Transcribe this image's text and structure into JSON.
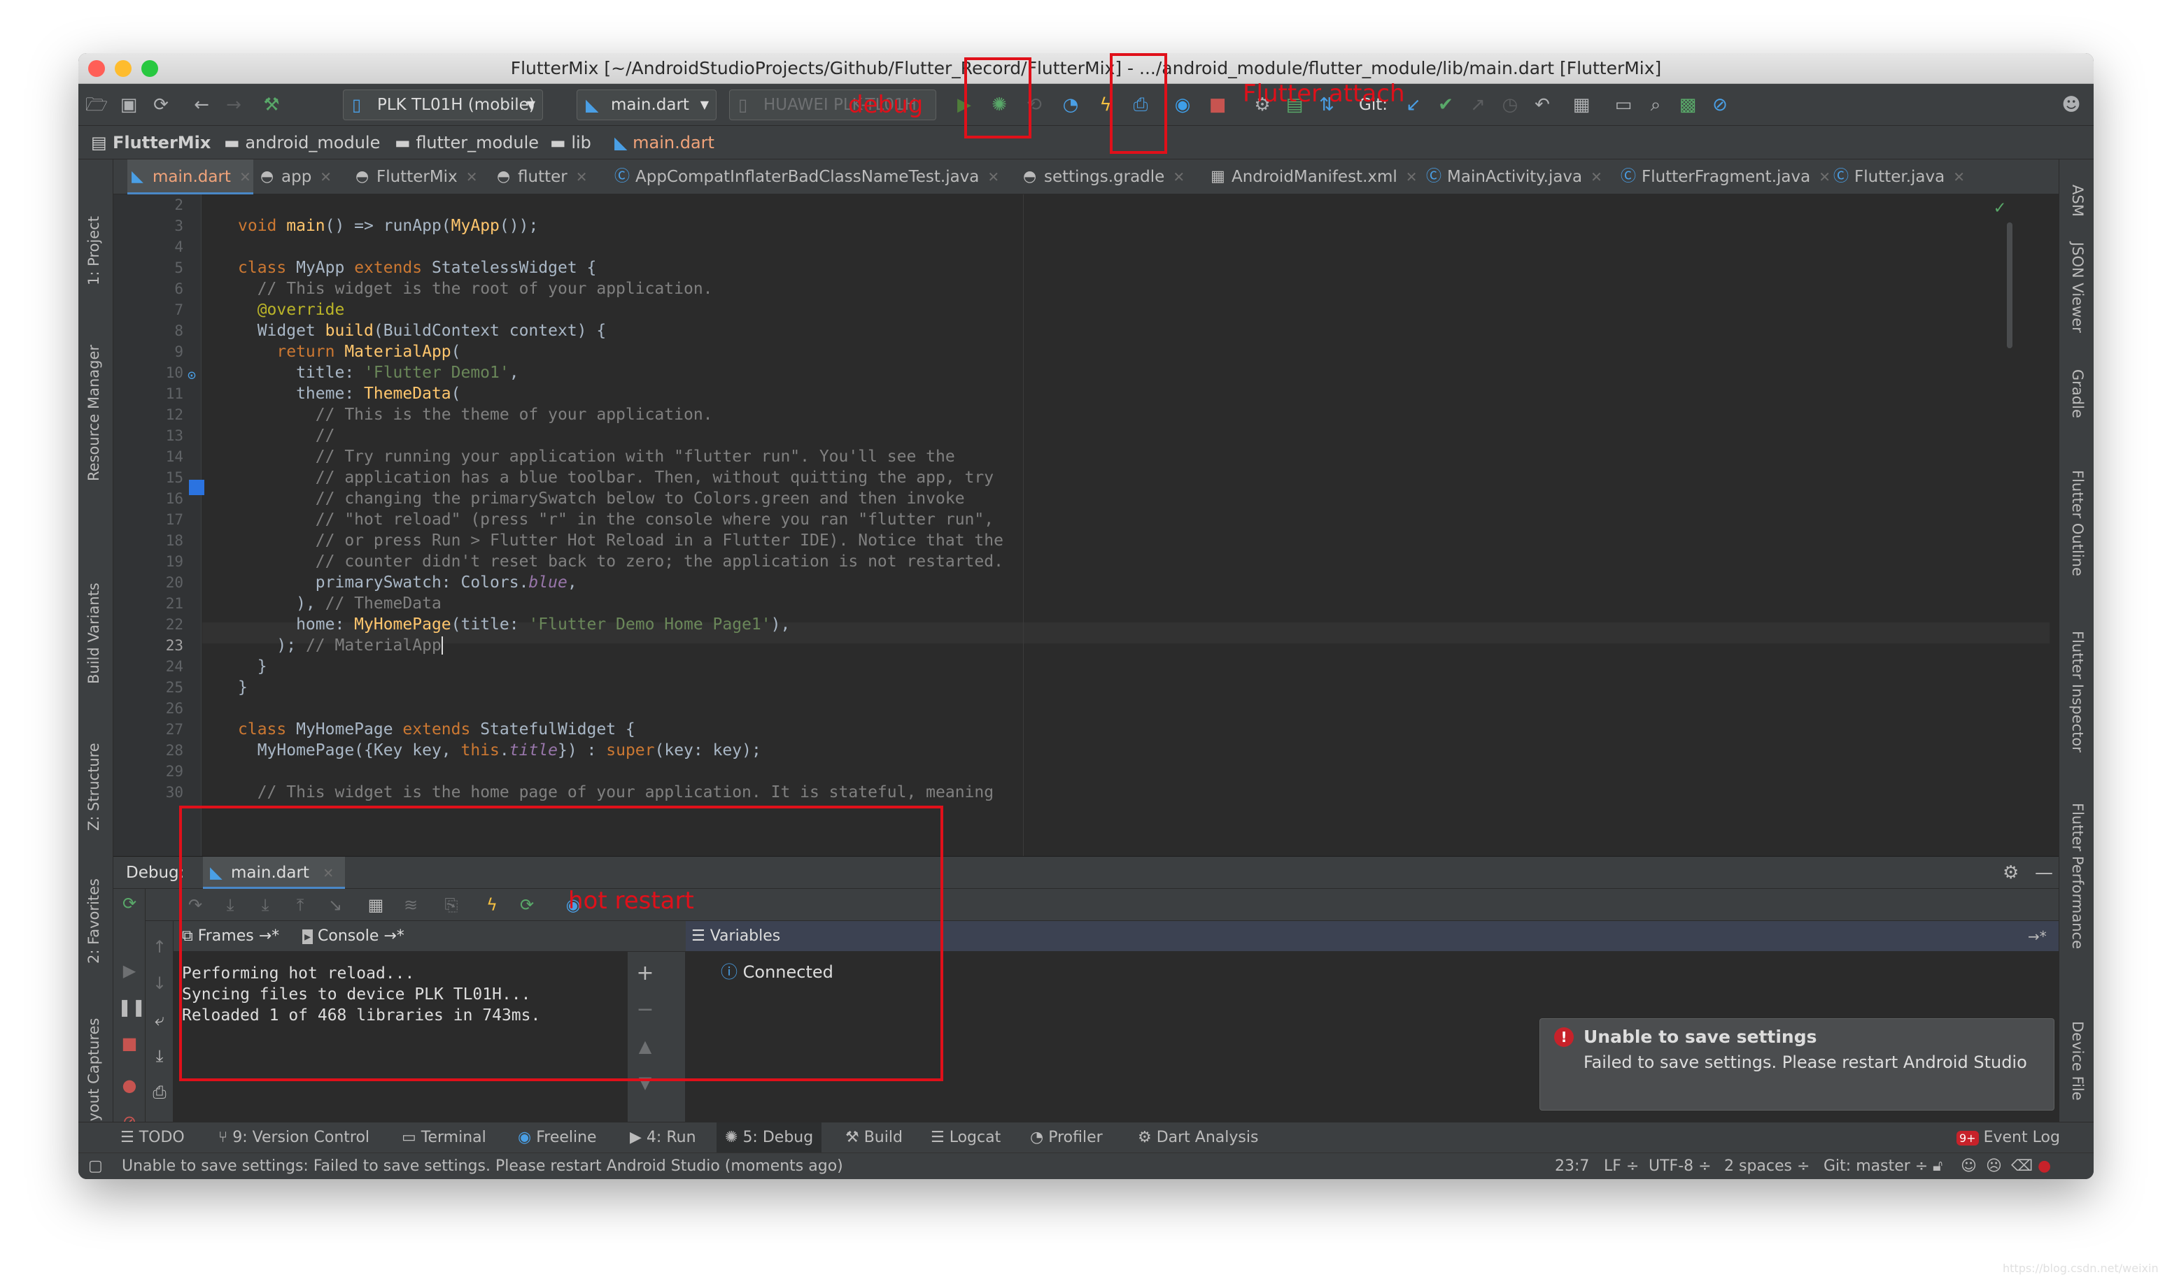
{
  "window": {
    "title": "FlutterMix [~/AndroidStudioProjects/Github/Flutter_Record/FlutterMix] - .../android_module/flutter_module/lib/main.dart [FlutterMix]"
  },
  "toolbar": {
    "run_config": "PLK TL01H (mobile)",
    "file_config": "main.dart",
    "device_selector": "HUAWEI PLK-TL01H",
    "vcs_label": "Git:"
  },
  "breadcrumbs": [
    "FlutterMix",
    "android_module",
    "flutter_module",
    "lib",
    "main.dart"
  ],
  "editor_tabs": [
    "main.dart",
    "app",
    "FlutterMix",
    "flutter",
    "AppCompatInflaterBadClassNameTest.java",
    "settings.gradle",
    "AndroidManifest.xml",
    "MainActivity.java",
    "FlutterFragment.java",
    "Flutter.java"
  ],
  "side_panels": {
    "left": [
      "1: Project",
      "Resource Manager",
      "Build Variants",
      "Z: Structure",
      "2: Favorites",
      "Layout Captures"
    ],
    "right": [
      "ASM",
      "JSON Viewer",
      "Gradle",
      "Flutter Outline",
      "Flutter Inspector",
      "Flutter Performance",
      "Device File"
    ]
  },
  "code": {
    "line_numbers": [
      "2",
      "3",
      "4",
      "5",
      "6",
      "7",
      "8",
      "9",
      "10",
      "11",
      "12",
      "13",
      "14",
      "15",
      "16",
      "17",
      "18",
      "19",
      "20",
      "21",
      "22",
      "23",
      "24",
      "25",
      "26",
      "27",
      "28",
      "29",
      "30"
    ],
    "current_line": "23"
  },
  "debug_panel": {
    "label": "Debug:",
    "tab": "main.dart",
    "frames_tab": "Frames →*",
    "console_tab": "Console →*",
    "variables_label": "Variables",
    "console_lines": [
      "Performing hot reload...",
      "Syncing files to device PLK TL01H...",
      "Reloaded 1 of 468 libraries in 743ms."
    ],
    "variables_status": "Connected"
  },
  "bottom_tabs": {
    "todo": "TODO",
    "version_control": "9: Version Control",
    "terminal": "Terminal",
    "freeline": "Freeline",
    "run": "4: Run",
    "debug": "5: Debug",
    "build": "Build",
    "logcat": "Logcat",
    "profiler": "Profiler",
    "dart_analysis": "Dart Analysis",
    "event_log": "Event Log",
    "event_badge": "9+"
  },
  "status_bar": {
    "message": "Unable to save settings: Failed to save settings. Please restart Android Studio (moments ago)",
    "position": "23:7",
    "line_sep": "LF ÷",
    "encoding": "UTF-8 ÷",
    "indent": "2 spaces ÷",
    "git": "Git: master ÷"
  },
  "notification": {
    "title": "Unable to save settings",
    "body": "Failed to save settings. Please restart Android Studio"
  },
  "annotations": {
    "debug": "debug",
    "flutter_attach": "Flutter attach",
    "hot_restart": "hot restart"
  },
  "watermark": "https://blog.csdn.net/weixin",
  "colors": {
    "annotation_red": "#e0101a",
    "editor_bg": "#2b2b2b",
    "chrome_bg": "#3c3f41",
    "keyword": "#cc7832",
    "string": "#6a8759"
  }
}
